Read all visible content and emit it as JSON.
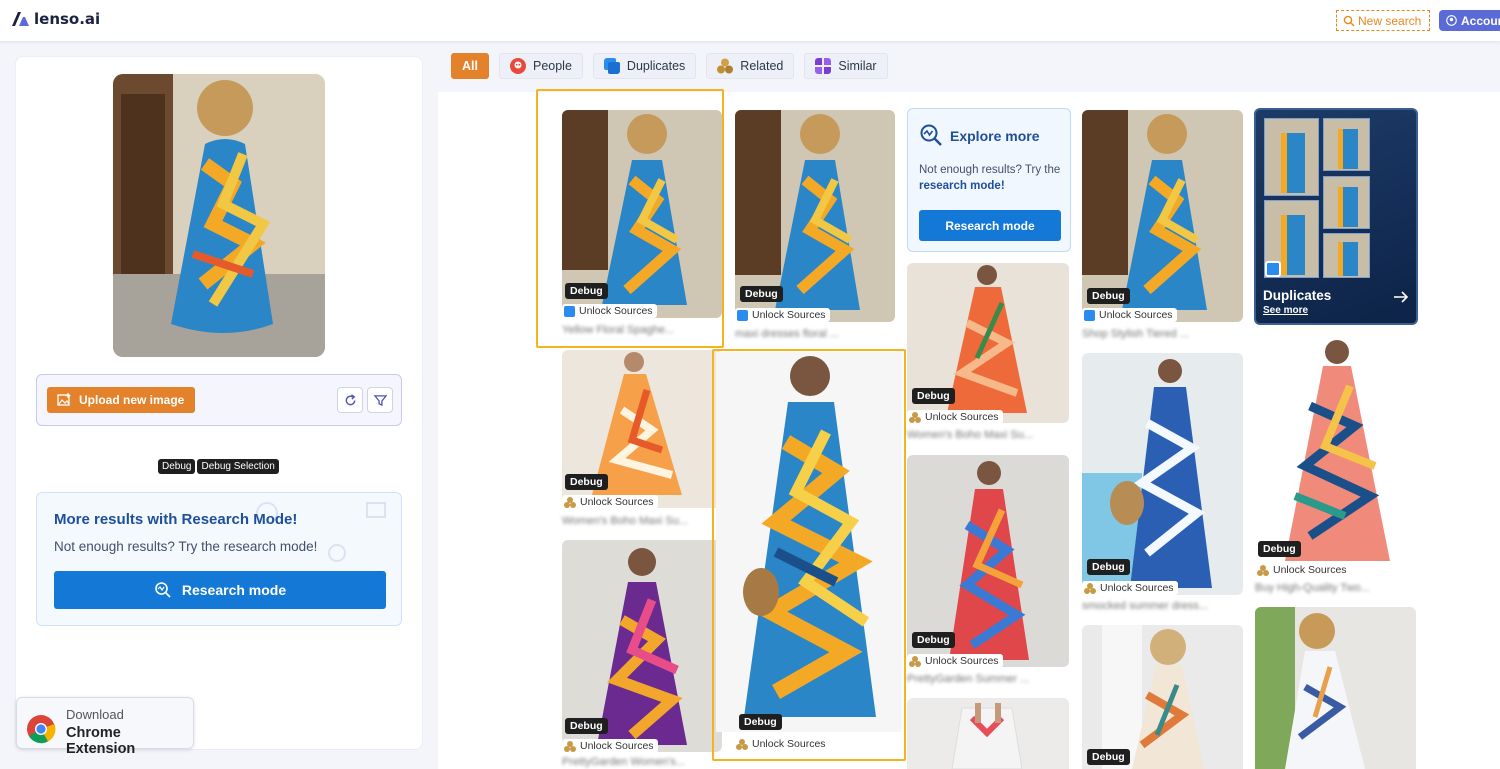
{
  "header": {
    "logo_text": "lenso.ai",
    "new_search_label": "New search",
    "account_label": "Accour"
  },
  "left": {
    "upload_label": "Upload new image",
    "debug_label": "Debug",
    "debug_selection_label": "Debug Selection",
    "research": {
      "title": "More results with Research Mode!",
      "subtitle": "Not enough results? Try the research mode!",
      "button_label": "Research mode"
    },
    "chrome": {
      "line1": "Download",
      "line2": "Chrome Extension"
    }
  },
  "tabs": [
    {
      "label": "All",
      "active": true
    },
    {
      "label": "People"
    },
    {
      "label": "Duplicates"
    },
    {
      "label": "Related"
    },
    {
      "label": "Similar"
    }
  ],
  "explore": {
    "title": "Explore more",
    "text_prefix": "Not enough results? Try the ",
    "text_link": "research mode!",
    "button_label": "Research mode"
  },
  "duplicates_card": {
    "title": "Duplicates",
    "see_more": "See more"
  },
  "results": [
    {
      "debug": "Debug",
      "sources": "Unlock Sources",
      "caption": "Yellow Floral Spaghe..."
    },
    {
      "debug": "Debug",
      "sources": "Unlock Sources",
      "caption": "maxi dresses floral ..."
    },
    {
      "debug": "Debug",
      "sources": "Unlock Sources",
      "caption": "Shop Stylish Tiered ..."
    },
    {
      "debug": "Debug",
      "sources": "Unlock Sources",
      "caption": "Women's Boho Maxi Su..."
    },
    {
      "debug": "Debug",
      "sources": "Unlock Sources",
      "caption": "Women's Boho Maxi Su..."
    },
    {
      "debug": "Debug",
      "sources": "Unlock Sources",
      "caption": "smocked summer dress..."
    },
    {
      "debug": "Debug",
      "sources": "Unlock Sources",
      "caption": "Buy High-Quality Two..."
    },
    {
      "debug": "Debug",
      "sources": "Unlock Sources",
      "caption": "PrettyGarden Summer ..."
    },
    {
      "debug": "Debug",
      "sources": "Unlock Sources",
      "caption": "PrettyGarden Women's..."
    },
    {
      "debug": "Debug",
      "sources": "Unlock Sources",
      "caption": ""
    },
    {
      "debug": "Debug"
    }
  ],
  "colors": {
    "accent_orange": "#e3822a",
    "primary_blue": "#1479d6",
    "highlight_yellow": "#f5b41f"
  }
}
